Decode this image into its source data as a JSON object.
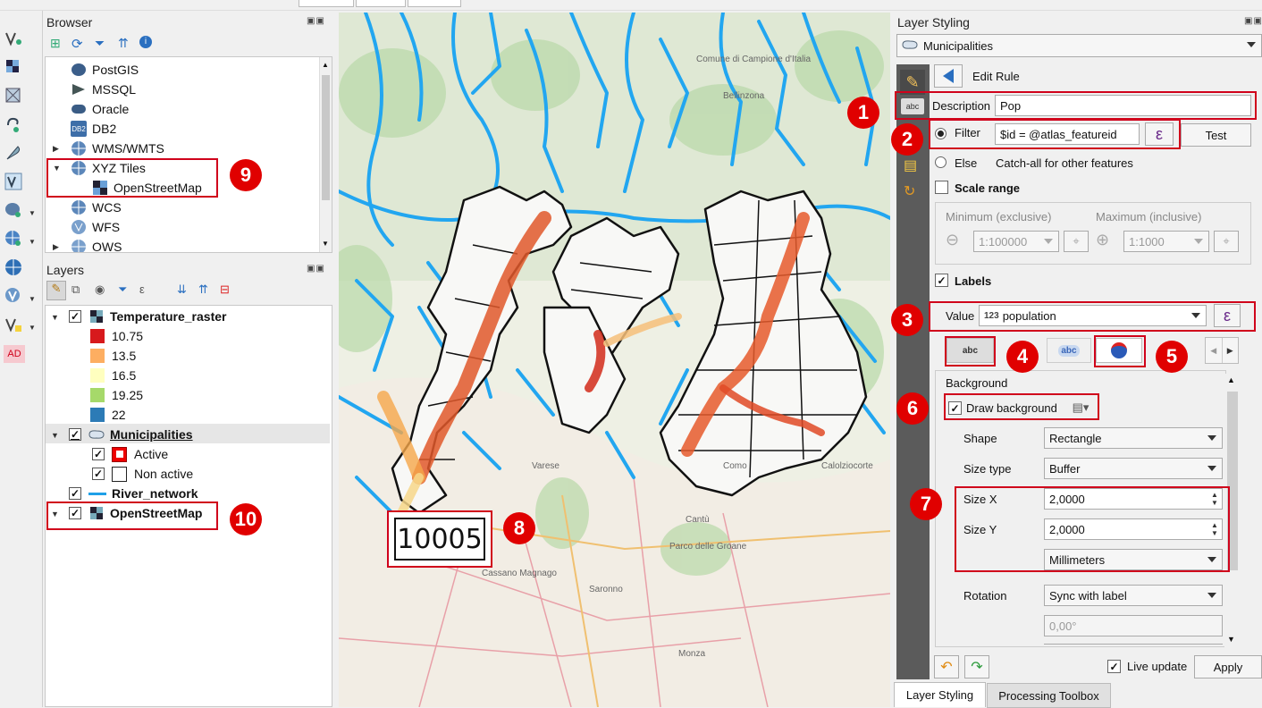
{
  "browser": {
    "title": "Browser",
    "items": [
      {
        "label": "PostGIS",
        "icon": "elephant-icon"
      },
      {
        "label": "MSSQL",
        "icon": "mssql-icon"
      },
      {
        "label": "Oracle",
        "icon": "oracle-icon"
      },
      {
        "label": "DB2",
        "icon": "db2-icon"
      },
      {
        "label": "WMS/WMTS",
        "icon": "globe-icon"
      },
      {
        "label": "XYZ Tiles",
        "icon": "globe-icon"
      },
      {
        "label": "OpenStreetMap",
        "icon": "tiles-icon"
      },
      {
        "label": "WCS",
        "icon": "globe-icon"
      },
      {
        "label": "WFS",
        "icon": "globe-icon"
      },
      {
        "label": "OWS",
        "icon": "globe-icon"
      }
    ]
  },
  "layers": {
    "title": "Layers",
    "temperature": {
      "name": "Temperature_raster",
      "classes": [
        {
          "label": "10.75",
          "color": "#d7191c"
        },
        {
          "label": "13.5",
          "color": "#fdae61"
        },
        {
          "label": "16.5",
          "color": "#ffffbf"
        },
        {
          "label": "19.25",
          "color": "#a6d96a"
        },
        {
          "label": "22",
          "color": "#2c7bb6"
        }
      ]
    },
    "municipalities": {
      "name": "Municipalities",
      "rules": [
        {
          "label": "Active"
        },
        {
          "label": "Non active"
        }
      ]
    },
    "river": {
      "name": "River_network"
    },
    "osm": {
      "name": "OpenStreetMap"
    }
  },
  "left_toolbar": {
    "ad_label": "AD"
  },
  "map": {
    "label_value": "10005"
  },
  "badges": [
    "1",
    "2",
    "3",
    "4",
    "5",
    "6",
    "7",
    "8",
    "9",
    "10"
  ],
  "styling": {
    "title": "Layer Styling",
    "layer": "Municipalities",
    "edit_rule": "Edit Rule",
    "description_label": "Description",
    "description_value": "Pop",
    "filter_label": "Filter",
    "filter_value": "$id =  @atlas_featureid",
    "test_button": "Test",
    "else_label": "Else",
    "else_desc": "Catch-all for other features",
    "scale_range": "Scale range",
    "min_label": "Minimum (exclusive)",
    "max_label": "Maximum (inclusive)",
    "min_value": "1:100000",
    "max_value": "1:1000",
    "labels_label": "Labels",
    "value_label": "Value",
    "value_prefix": "123",
    "value_field": "population",
    "background_section": "Background",
    "draw_background": "Draw background",
    "shape_label": "Shape",
    "shape_value": "Rectangle",
    "size_type_label": "Size type",
    "size_type_value": "Buffer",
    "size_x_label": "Size X",
    "size_x_value": "2,0000",
    "size_y_label": "Size Y",
    "size_y_value": "2,0000",
    "units_value": "Millimeters",
    "rotation_label": "Rotation",
    "rotation_value": "Sync with label",
    "rotation_angle": "0,00°",
    "live_update": "Live update",
    "apply": "Apply",
    "tab_abc_text": "abc",
    "tab_abc_bg": "abc"
  },
  "bottom_tabs": {
    "styling": "Layer Styling",
    "processing": "Processing Toolbox"
  }
}
